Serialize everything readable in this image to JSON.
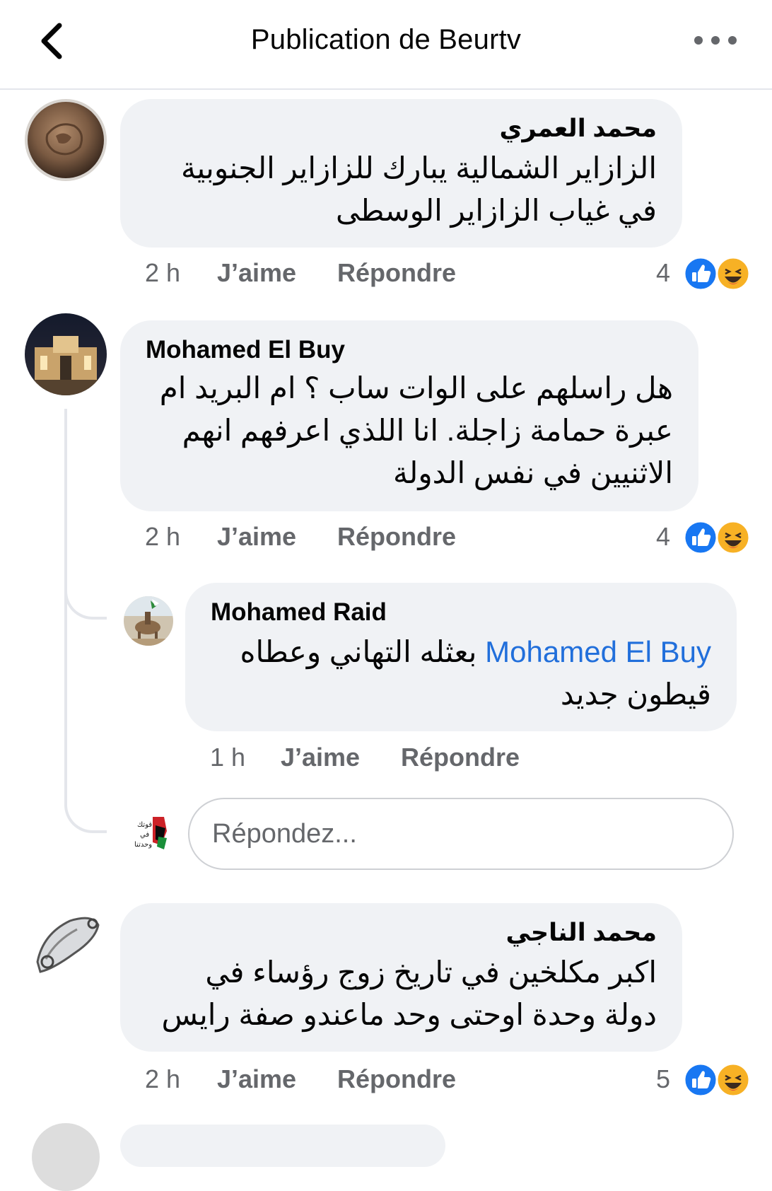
{
  "header": {
    "title": "Publication de Beurtv"
  },
  "comments": [
    {
      "author": "محمد العمري",
      "text": "الزازاير الشمالية يبارك للزازاير الجنوبية في غياب الزازاير الوسطى",
      "time": "2 h",
      "like_label": "J’aime",
      "reply_label": "Répondre",
      "reaction_count": "4"
    },
    {
      "author": "Mohamed El Buy",
      "text": "هل راسلهم على الوات ساب ؟ ام البريد  ام عبرة حمامة زاجلة. انا اللذي اعرفهم انهم الاثنيين في نفس الدولة",
      "time": "2 h",
      "like_label": "J’aime",
      "reply_label": "Répondre",
      "reaction_count": "4",
      "replies": [
        {
          "author": "Mohamed Raid",
          "mention": "Mohamed El Buy",
          "text": "بعثله التهاني وعطاه قيطون جديد",
          "time": "1 h",
          "like_label": "J’aime",
          "reply_label": "Répondre"
        }
      ]
    },
    {
      "author": "محمد الناجي",
      "text": "اكبر مكلخين في تاريخ زوج رؤساء في دولة وحدة اوحتى وحد ماعندو صفة رايس",
      "time": "2 h",
      "like_label": "J’aime",
      "reply_label": "Répondre",
      "reaction_count": "5"
    }
  ],
  "reply_box": {
    "placeholder": "Répondez..."
  },
  "colors": {
    "bubble": "#f0f2f5",
    "meta": "#65676b",
    "mention": "#216fdb",
    "like": "#1877f2",
    "haha": "#f7b125"
  }
}
